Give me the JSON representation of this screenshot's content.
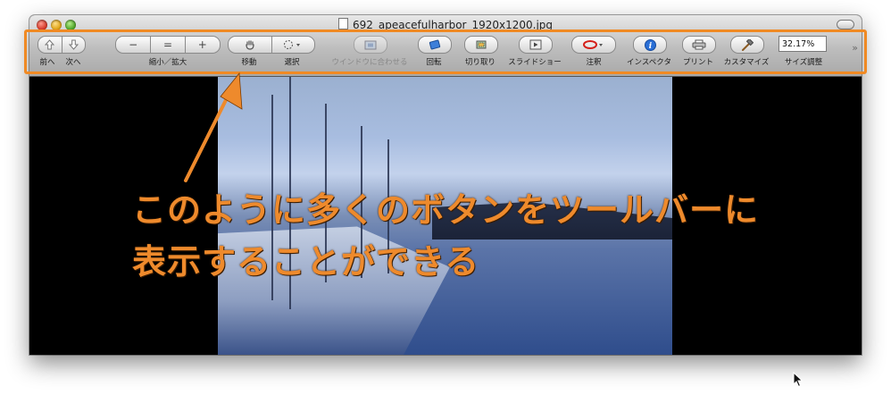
{
  "window": {
    "title": "692_apeacefulharbor_1920x1200.jpg"
  },
  "toolbar": {
    "items": [
      {
        "label": "前へ",
        "icon": "arrow-up-icon"
      },
      {
        "label": "次へ",
        "icon": "arrow-down-icon"
      },
      {
        "label": "縮小／拡大",
        "icon": "zoom-icon",
        "buttons": [
          "−",
          "=",
          "+"
        ]
      },
      {
        "label": "移動",
        "icon": "hand-icon"
      },
      {
        "label": "選択",
        "icon": "selection-icon"
      },
      {
        "label": "ウインドウに合わせる",
        "icon": "fit-window-icon",
        "disabled": true
      },
      {
        "label": "回転",
        "icon": "rotate-icon"
      },
      {
        "label": "切り取り",
        "icon": "crop-icon"
      },
      {
        "label": "スライドショー",
        "icon": "slideshow-icon"
      },
      {
        "label": "注釈",
        "icon": "annotate-oval-icon"
      },
      {
        "label": "インスペクタ",
        "icon": "info-icon"
      },
      {
        "label": "プリント",
        "icon": "printer-icon"
      },
      {
        "label": "カスタマイズ",
        "icon": "hammer-icon"
      },
      {
        "label": "サイズ調整",
        "value": "32.17%"
      }
    ],
    "overflow_icon": "double-chevron-icon"
  },
  "annotation": {
    "line1": "このように多くのボタンをツールバーに",
    "line2": "表示することができる",
    "color": "#ee8a2c"
  },
  "colors": {
    "highlight": "#f08a24",
    "info_blue": "#2a6fd6",
    "annotate_red": "#d4201a"
  }
}
